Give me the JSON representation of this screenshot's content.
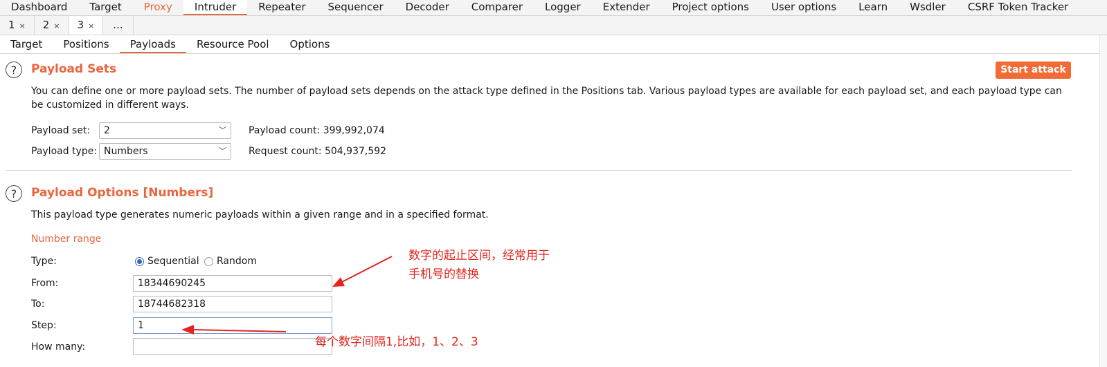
{
  "main_tabs": [
    "Dashboard",
    "Target",
    "Proxy",
    "Intruder",
    "Repeater",
    "Sequencer",
    "Decoder",
    "Comparer",
    "Logger",
    "Extender",
    "Project options",
    "User options",
    "Learn",
    "Wsdler",
    "CSRF Token Tracker"
  ],
  "instance_tabs": [
    {
      "label": "1",
      "close": "×"
    },
    {
      "label": "2",
      "close": "×"
    },
    {
      "label": "3",
      "close": "×"
    },
    {
      "label": "...",
      "close": ""
    }
  ],
  "sub_tabs": [
    "Target",
    "Positions",
    "Payloads",
    "Resource Pool",
    "Options"
  ],
  "payload_sets": {
    "title": "Payload Sets",
    "start_attack": "Start attack",
    "description": "You can define one or more payload sets. The number of payload sets depends on the attack type defined in the Positions tab. Various payload types are available for each payload set, and each payload type can be customized in different ways.",
    "set_label": "Payload set:",
    "set_value": "2",
    "type_label": "Payload type:",
    "type_value": "Numbers",
    "payload_count": "Payload count: 399,992,074",
    "request_count": "Request count: 504,937,592"
  },
  "payload_options": {
    "title": "Payload Options [Numbers]",
    "description": "This payload type generates numeric payloads within a given range and in a specified format.",
    "range_header": "Number range",
    "type_label": "Type:",
    "sequential": "Sequential",
    "random": "Random",
    "from_label": "From:",
    "from_value": "18344690245",
    "to_label": "To:",
    "to_value": "18744682318",
    "step_label": "Step:",
    "step_value": "1",
    "howmany_label": "How many:",
    "howmany_value": ""
  },
  "annotations": {
    "range_line1": "数字的起止区间，经常用于",
    "range_line2": "手机号的替换",
    "step_note": "每个数字间隔1,比如，1、2、3"
  },
  "colors": {
    "accent": "#e8663d",
    "annotation": "#e0261e",
    "radio": "#2d6bb5"
  },
  "icons": {
    "help": "?",
    "chevron": "﹀"
  }
}
